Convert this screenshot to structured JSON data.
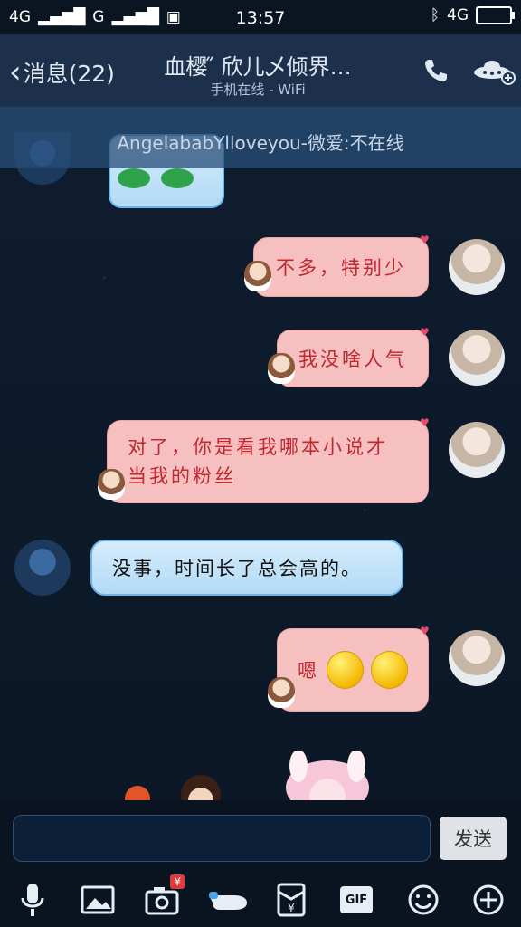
{
  "status_bar": {
    "network_left": "4G",
    "network_right": "G",
    "time": "13:57",
    "signal_right": "4G"
  },
  "header": {
    "back_label": "消息(22)",
    "title": "血樱 ̋ 欣儿乄倾界…",
    "subtitle": "手机在线 - WiFi"
  },
  "banner": {
    "text": "AngelababYlloveyou-微爱:不在线"
  },
  "messages": [
    {
      "side": "right",
      "text": "不多，特别少"
    },
    {
      "side": "right",
      "text": "我没啥人气"
    },
    {
      "side": "right",
      "text": "对了，你是看我哪本小说才当我的粉丝"
    },
    {
      "side": "left",
      "text": "没事，时间长了总会高的。"
    },
    {
      "side": "right",
      "text": "嗯"
    }
  ],
  "composer": {
    "send_label": "发送"
  },
  "toolbar": {
    "badge": "¥",
    "gif_label": "GIF"
  },
  "icons": [
    "phone-icon",
    "ufo-icon",
    "mic-icon",
    "image-icon",
    "camera-icon",
    "finger-icon",
    "red-packet-icon",
    "gif-icon",
    "emoji-icon",
    "plus-icon"
  ]
}
